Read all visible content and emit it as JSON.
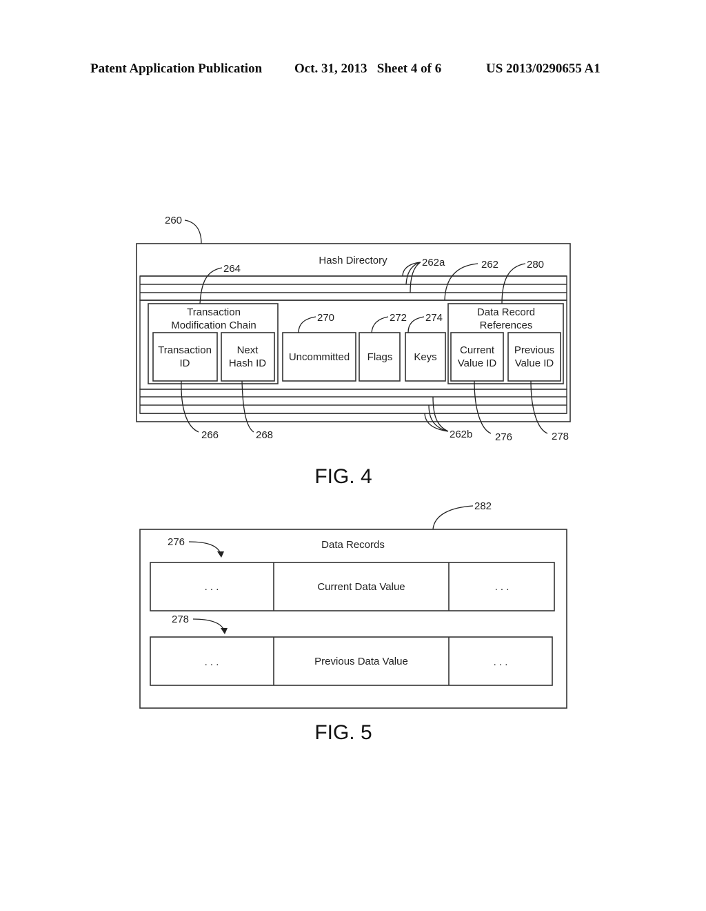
{
  "header": {
    "publication": "Patent Application Publication",
    "date_sheet": "Oct. 31, 2013   Sheet 4 of 6",
    "number": "US 2013/0290655 A1"
  },
  "fig4": {
    "caption": "FIG. 4",
    "title": "Hash Directory",
    "tmc": {
      "title_line1": "Transaction",
      "title_line2": "Modification Chain",
      "cell1_line1": "Transaction",
      "cell1_line2": "ID",
      "cell2_line1": "Next",
      "cell2_line2": "Hash ID"
    },
    "uncommitted": "Uncommitted",
    "flags": "Flags",
    "keys": "Keys",
    "drr": {
      "title_line1": "Data Record",
      "title_line2": "References",
      "cell1_line1": "Current",
      "cell1_line2": "Value ID",
      "cell2_line1": "Previous",
      "cell2_line2": "Value ID"
    },
    "refs": {
      "r260": "260",
      "r264": "264",
      "r262a": "262a",
      "r262": "262",
      "r280": "280",
      "r270": "270",
      "r272": "272",
      "r274": "274",
      "r266": "266",
      "r268": "268",
      "r262b": "262b",
      "r276": "276",
      "r278": "278"
    }
  },
  "fig5": {
    "caption": "FIG. 5",
    "title": "Data Records",
    "row1": {
      "left": ". . .",
      "middle": "Current Data Value",
      "right": ". . ."
    },
    "row2": {
      "left": ". . .",
      "middle": "Previous Data Value",
      "right": ". . ."
    },
    "refs": {
      "r282": "282",
      "r276": "276",
      "r278": "278"
    }
  }
}
